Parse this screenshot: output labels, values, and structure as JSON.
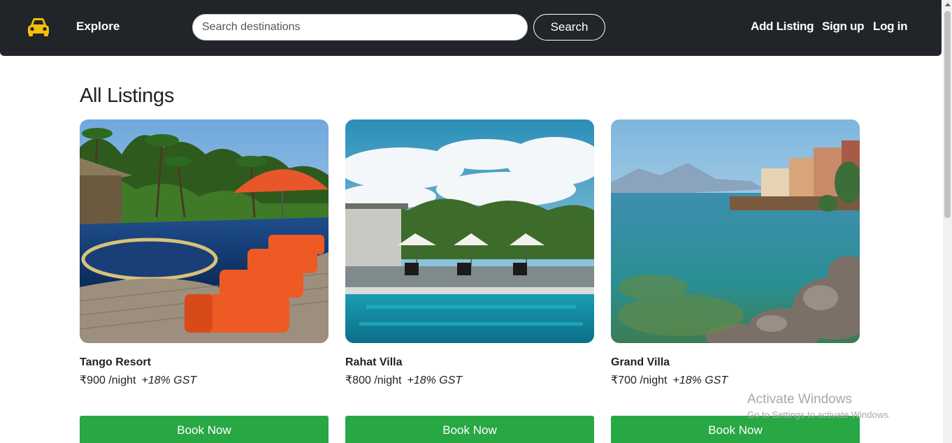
{
  "nav": {
    "logo_icon": "car-icon",
    "explore_label": "Explore",
    "search_placeholder": "Search destinations",
    "search_button_label": "Search",
    "add_listing_label": "Add Listing",
    "signup_label": "Sign up",
    "login_label": "Log in"
  },
  "page": {
    "title": "All Listings"
  },
  "listings": [
    {
      "title": "Tango Resort",
      "price": "₹900 /night",
      "gst": "+18% GST",
      "button_label": "Book Now"
    },
    {
      "title": "Rahat Villa",
      "price": "₹800 /night",
      "gst": "+18% GST",
      "button_label": "Book Now"
    },
    {
      "title": "Grand Villa",
      "price": "₹700 /night",
      "gst": "+18% GST",
      "button_label": "Book Now"
    }
  ],
  "watermark": {
    "title": "Activate Windows",
    "subtitle": "Go to Settings to activate Windows."
  },
  "colors": {
    "navbar": "#212529",
    "accent_logo": "#f5bf0a",
    "book_button": "#28a745"
  }
}
